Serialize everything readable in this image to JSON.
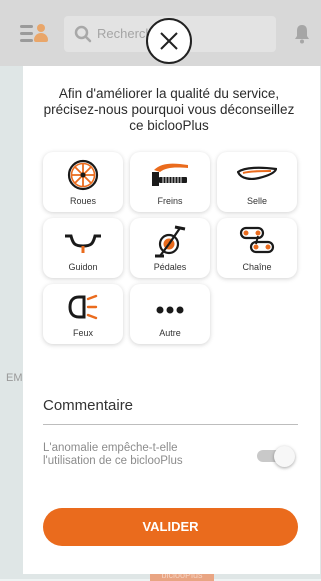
{
  "app": {
    "search_placeholder": "Recherche",
    "background_fragment": "EM",
    "background_button": "biclooPlus"
  },
  "modal": {
    "intro_text": "Afin d'améliorer la qualité du service, précisez-nous pourquoi vous déconseillez ce biclooPlus",
    "options": [
      {
        "label": "Roues",
        "icon": "wheel-icon"
      },
      {
        "label": "Freins",
        "icon": "brake-icon"
      },
      {
        "label": "Selle",
        "icon": "saddle-icon"
      },
      {
        "label": "Guidon",
        "icon": "handlebar-icon"
      },
      {
        "label": "Pédales",
        "icon": "pedal-icon"
      },
      {
        "label": "Chaîne",
        "icon": "chain-icon"
      },
      {
        "label": "Feux",
        "icon": "light-icon"
      },
      {
        "label": "Autre",
        "icon": "more-icon"
      }
    ],
    "comment_label": "Commentaire",
    "question": "L'anomalie empêche-t-elle l'utilisation de ce biclooPlus",
    "toggle_on": true,
    "validate_label": "VALIDER"
  },
  "colors": {
    "accent": "#ea6b1d",
    "accent_light": "#f4a15e",
    "dark": "#1a1a1a"
  }
}
